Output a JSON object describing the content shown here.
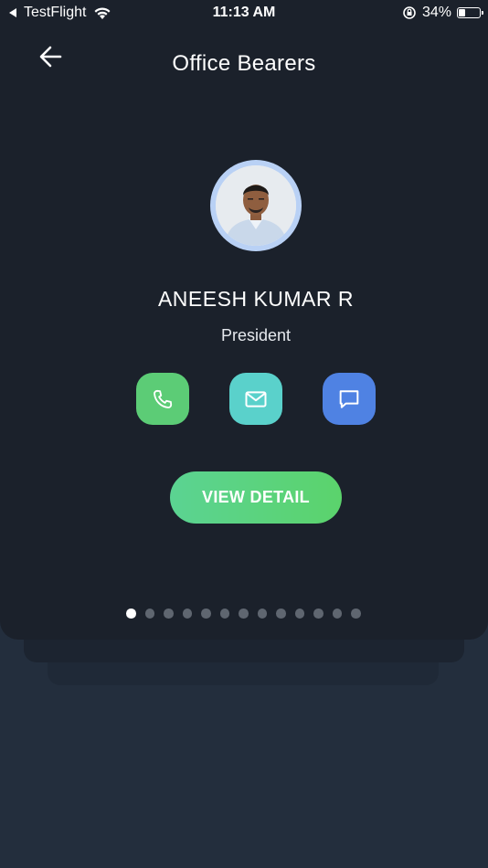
{
  "status_bar": {
    "back_app": "TestFlight",
    "time": "11:13 AM",
    "battery_percent_label": "34%",
    "battery_level": 0.34
  },
  "header": {
    "title": "Office Bearers",
    "back_icon": "arrow-left-icon"
  },
  "profile": {
    "name": "ANEESH KUMAR R",
    "role": "President",
    "avatar_ring_color": "#b9d1f5"
  },
  "actions": [
    {
      "name": "call",
      "icon": "phone-icon",
      "color": "#5ccc76"
    },
    {
      "name": "mail",
      "icon": "mail-icon",
      "color": "#5ad1cb"
    },
    {
      "name": "chat",
      "icon": "chat-icon",
      "color": "#4f82e3"
    }
  ],
  "view_detail_label": "VIEW DETAIL",
  "pagination": {
    "total": 13,
    "active_index": 0
  },
  "colors": {
    "card_bg": "#1b212b",
    "page_bg": "#232e3d",
    "accent_green": "#5bd36c"
  }
}
